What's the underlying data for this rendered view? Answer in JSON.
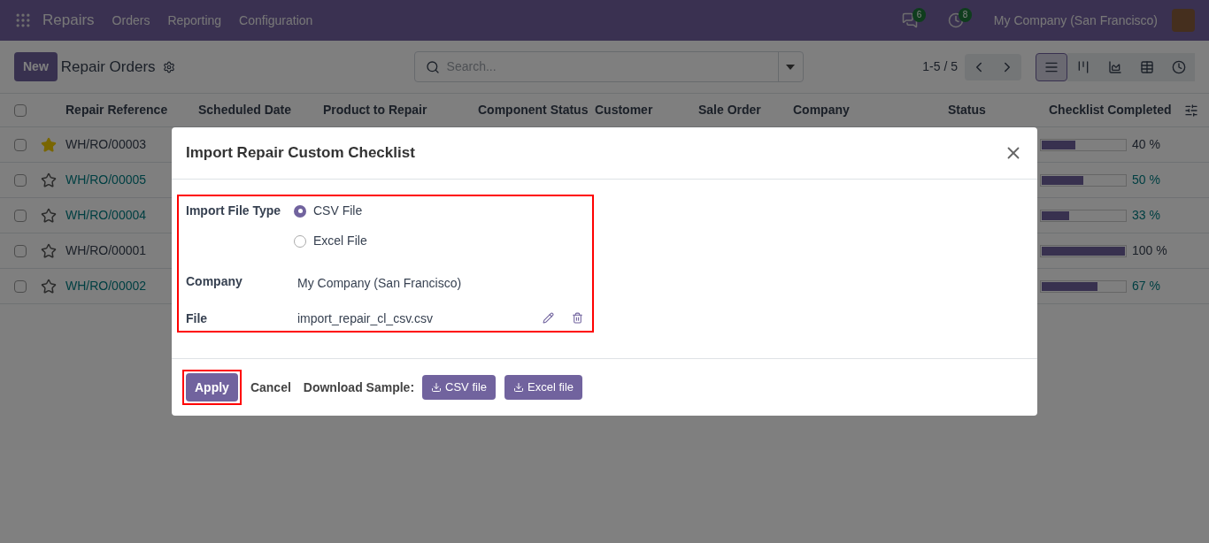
{
  "navbar": {
    "app": "Repairs",
    "menu": [
      "Orders",
      "Reporting",
      "Configuration"
    ],
    "messages_count": "6",
    "activities_count": "8",
    "company": "My Company (San Francisco)"
  },
  "control_panel": {
    "new_button": "New",
    "title": "Repair Orders",
    "search": {
      "placeholder": "Search..."
    },
    "pager": "1-5 / 5",
    "views": [
      {
        "kind": "list",
        "selected": true
      },
      {
        "kind": "kanban",
        "selected": false
      },
      {
        "kind": "graph",
        "selected": false
      },
      {
        "kind": "pivot",
        "selected": false
      },
      {
        "kind": "activity",
        "selected": false
      }
    ]
  },
  "table": {
    "select_all_checked": false,
    "columns": [
      "Repair Reference",
      "Scheduled Date",
      "Product to Repair",
      "Component Status",
      "Customer",
      "Sale Order",
      "Company",
      "Status",
      "Checklist Completed"
    ],
    "rows": [
      {
        "selected": false,
        "starred": true,
        "reference": "WH/RO/00003",
        "highlighted": false,
        "level": 0.4,
        "percent": "40 %"
      },
      {
        "selected": false,
        "starred": false,
        "reference": "WH/RO/00005",
        "highlighted": true,
        "level": 0.5,
        "percent": "50 %"
      },
      {
        "selected": false,
        "starred": false,
        "reference": "WH/RO/00004",
        "highlighted": true,
        "level": 0.33,
        "percent": "33 %"
      },
      {
        "selected": false,
        "starred": false,
        "reference": "WH/RO/00001",
        "highlighted": false,
        "level": 1,
        "percent": "100 %"
      },
      {
        "selected": false,
        "starred": false,
        "reference": "WH/RO/00002",
        "highlighted": true,
        "level": 0.67,
        "percent": "67 %"
      }
    ]
  },
  "dialog": {
    "title": "Import Repair Custom Checklist",
    "import_file_type_label": "Import File Type",
    "file_types": [
      {
        "label": "CSV File",
        "selected": true
      },
      {
        "label": "Excel File",
        "selected": false
      }
    ],
    "company_label": "Company",
    "company": "My Company (San Francisco)",
    "file_label": "File",
    "file": "import_repair_cl_csv.csv",
    "apply": "Apply",
    "cancel": "Cancel",
    "download_label": "Download Sample:",
    "downloads": [
      "CSV file",
      "Excel file"
    ]
  }
}
